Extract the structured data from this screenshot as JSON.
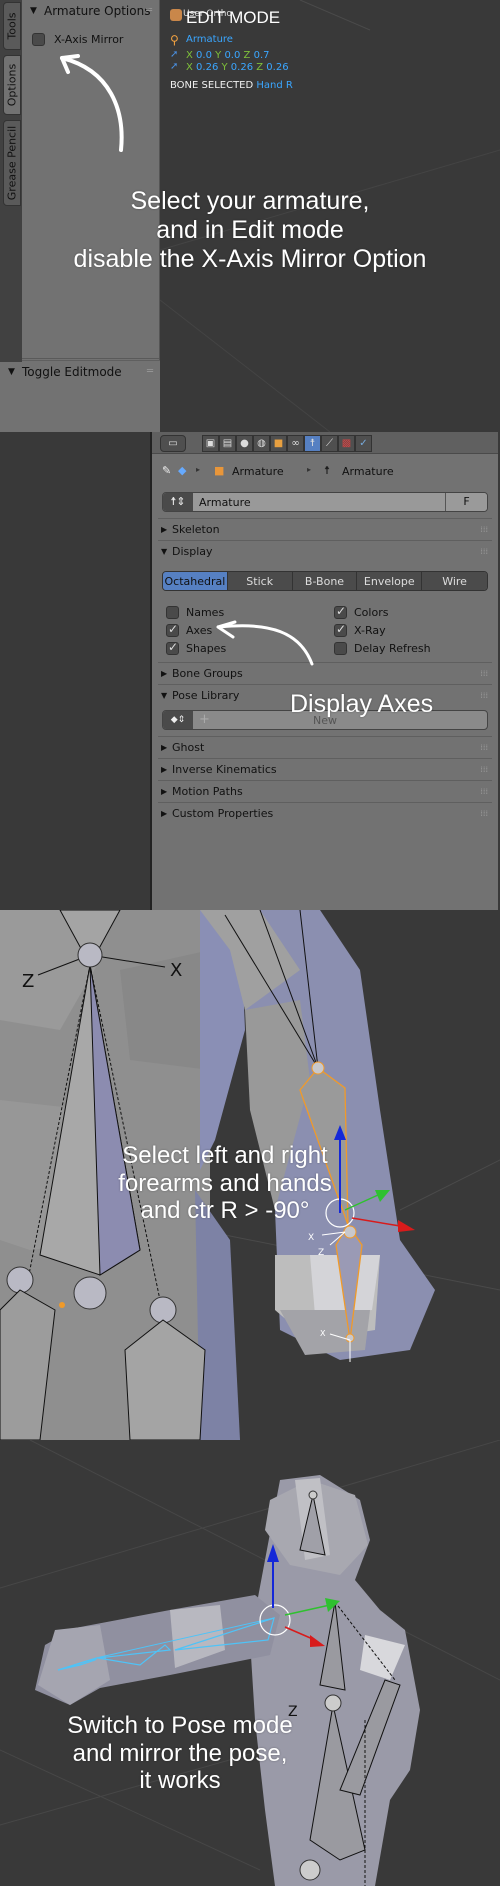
{
  "section1": {
    "vertical_tabs": [
      "Tools",
      "Options",
      "Grease Pencil"
    ],
    "active_tab": "Options",
    "armature_options": {
      "title": "Armature Options",
      "x_axis_mirror": {
        "label": "X-Axis Mirror",
        "checked": false
      }
    },
    "toggle_editmode": {
      "title": "Toggle Editmode"
    },
    "viewport": {
      "view_label": "User Ortho",
      "mode_overlay": "EDIT MODE",
      "object_name": "Armature",
      "head": {
        "x_label": "X",
        "x": "0.0",
        "y_label": "Y",
        "y": "0.0",
        "z_label": "Z",
        "z": "0.7"
      },
      "tail": {
        "x_label": "X",
        "x": "0.26",
        "y_label": "Y",
        "y": "0.26",
        "z_label": "Z",
        "z": "0.26"
      },
      "bone_selected_label": "BONE SELECTED",
      "bone_selected_value": "Hand R"
    },
    "caption": [
      "Select your armature,",
      "and in Edit mode",
      "disable the X-Axis Mirror Option"
    ]
  },
  "section2": {
    "context_icons": [
      "render-icon",
      "render-layers-icon",
      "scene-icon",
      "world-icon",
      "object-icon",
      "constraints-icon",
      "armature-data-icon",
      "bone-icon",
      "texture-icon",
      "physics-icon"
    ],
    "active_context": "armature-data-icon",
    "breadcrumb": [
      "Armature",
      "Armature"
    ],
    "datablock": {
      "name": "Armature",
      "fake_user": "F"
    },
    "panels": {
      "skeleton": "Skeleton",
      "display": "Display",
      "bone_groups": "Bone Groups",
      "pose_library": "Pose Library",
      "ghost": "Ghost",
      "inverse_kinematics": "Inverse Kinematics",
      "motion_paths": "Motion Paths",
      "custom_properties": "Custom Properties"
    },
    "display_types": [
      "Octahedral",
      "Stick",
      "B-Bone",
      "Envelope",
      "Wire"
    ],
    "active_display_type": "Octahedral",
    "display_options": [
      {
        "label": "Names",
        "checked": false
      },
      {
        "label": "Colors",
        "checked": true
      },
      {
        "label": "Axes",
        "checked": true
      },
      {
        "label": "X-Ray",
        "checked": true
      },
      {
        "label": "Shapes",
        "checked": true
      },
      {
        "label": "Delay Refresh",
        "checked": false
      }
    ],
    "pose_library_new": "New",
    "caption": "Display Axes"
  },
  "section3": {
    "caption": [
      "Select left and right",
      "forearms and hands",
      "and ctr R > -90°"
    ]
  },
  "section4": {
    "caption": [
      "Switch to Pose mode",
      "and mirror the pose,",
      "it works"
    ]
  },
  "colors": {
    "accent": "#5680c2",
    "panel": "#727272",
    "background": "#393939",
    "selected_bone": "#f09a2a",
    "pose_bone": "#4fc3f7"
  }
}
